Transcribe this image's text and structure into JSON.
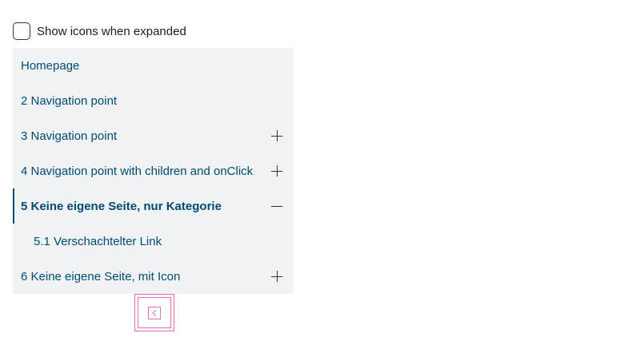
{
  "options": {
    "show_icons_label": "Show icons when expanded",
    "show_icons_checked": false
  },
  "navigation": {
    "items": [
      {
        "label": "Homepage",
        "toggle": "none"
      },
      {
        "label": "2 Navigation point",
        "toggle": "none"
      },
      {
        "label": "3 Navigation point",
        "toggle": "plus"
      },
      {
        "label": "4 Navigation point with children and onClick",
        "toggle": "plus"
      },
      {
        "label": "5 Keine eigene Seite, nur Kategorie",
        "toggle": "minus",
        "active": true
      },
      {
        "label": "5.1 Verschachtelter Link",
        "toggle": "none",
        "child": true
      },
      {
        "label": "6 Keine eigene Seite, mit Icon",
        "toggle": "plus"
      }
    ]
  },
  "collapse_button": {
    "icon": "chevron-left-icon"
  },
  "colors": {
    "link": "#004b76",
    "panel_background": "#f1f2f4",
    "focus_outline": "#e86bb4"
  }
}
